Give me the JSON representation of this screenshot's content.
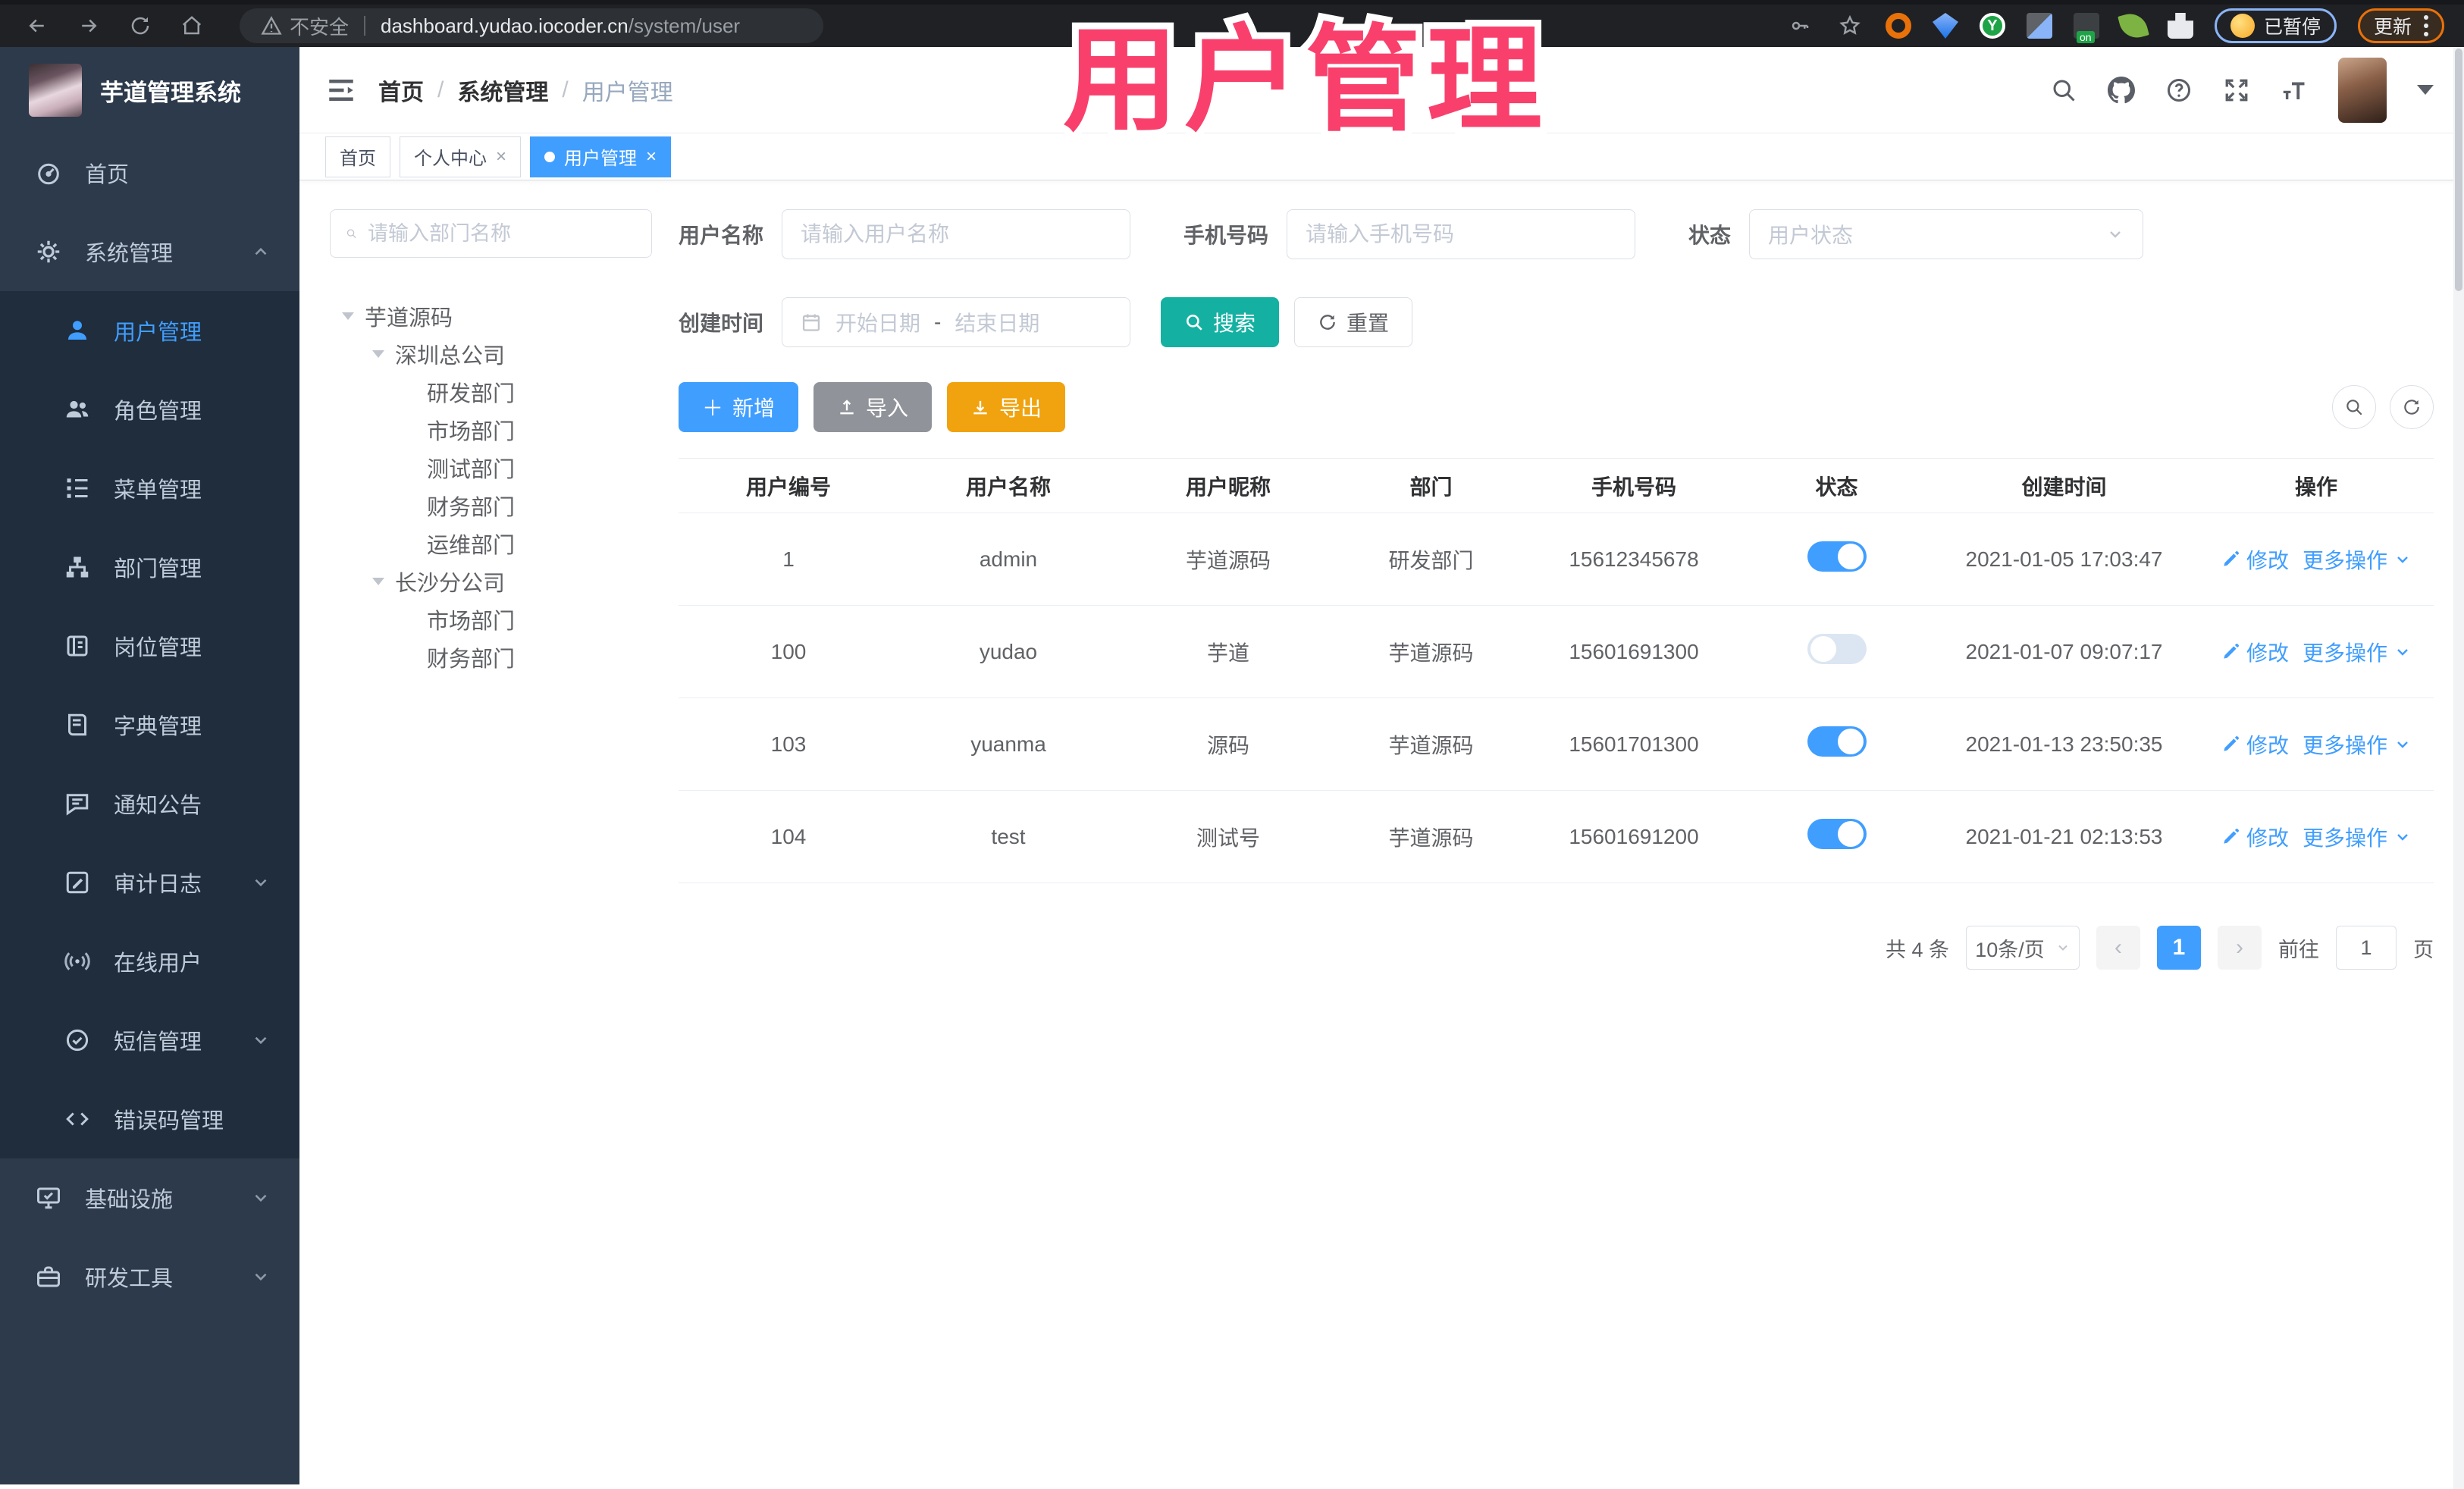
{
  "browser": {
    "security_label": "不安全",
    "url_domain": "dashboard.yudao.iocoder.cn",
    "url_path": "/system/user",
    "paused_label": "已暂停",
    "update_label": "更新"
  },
  "overlay_title": "用户管理",
  "sidebar": {
    "app_title": "芋道管理系统",
    "menu": {
      "home": "首页",
      "system": "系统管理"
    },
    "submenu": [
      {
        "label": "用户管理"
      },
      {
        "label": "角色管理"
      },
      {
        "label": "菜单管理"
      },
      {
        "label": "部门管理"
      },
      {
        "label": "岗位管理"
      },
      {
        "label": "字典管理"
      },
      {
        "label": "通知公告"
      },
      {
        "label": "审计日志"
      },
      {
        "label": "在线用户"
      },
      {
        "label": "短信管理"
      },
      {
        "label": "错误码管理"
      }
    ],
    "groups": [
      {
        "label": "基础设施"
      },
      {
        "label": "研发工具"
      }
    ]
  },
  "header": {
    "breadcrumb": [
      "首页",
      "系统管理",
      "用户管理"
    ]
  },
  "tabs": [
    {
      "label": "首页"
    },
    {
      "label": "个人中心"
    },
    {
      "label": "用户管理"
    }
  ],
  "dept": {
    "search_placeholder": "请输入部门名称",
    "tree": [
      {
        "label": "芋道源码"
      },
      {
        "label": "深圳总公司"
      },
      {
        "label": "研发部门"
      },
      {
        "label": "市场部门"
      },
      {
        "label": "测试部门"
      },
      {
        "label": "财务部门"
      },
      {
        "label": "运维部门"
      },
      {
        "label": "长沙分公司"
      },
      {
        "label": "市场部门"
      },
      {
        "label": "财务部门"
      }
    ]
  },
  "filters": {
    "name_label": "用户名称",
    "name_placeholder": "请输入用户名称",
    "phone_label": "手机号码",
    "phone_placeholder": "请输入手机号码",
    "status_label": "状态",
    "status_placeholder": "用户状态",
    "time_label": "创建时间",
    "date_start": "开始日期",
    "date_separator": "-",
    "date_end": "结束日期",
    "search_label": "搜索",
    "reset_label": "重置"
  },
  "toolbar": {
    "add_label": "新增",
    "import_label": "导入",
    "export_label": "导出"
  },
  "table": {
    "columns": [
      "用户编号",
      "用户名称",
      "用户昵称",
      "部门",
      "手机号码",
      "状态",
      "创建时间",
      "操作"
    ],
    "rows": [
      {
        "id": "1",
        "username": "admin",
        "nickname": "芋道源码",
        "dept": "研发部门",
        "phone": "15612345678",
        "status_on": true,
        "created": "2021-01-05 17:03:47"
      },
      {
        "id": "100",
        "username": "yudao",
        "nickname": "芋道",
        "dept": "芋道源码",
        "phone": "15601691300",
        "status_on": false,
        "created": "2021-01-07 09:07:17"
      },
      {
        "id": "103",
        "username": "yuanma",
        "nickname": "源码",
        "dept": "芋道源码",
        "phone": "15601701300",
        "status_on": true,
        "created": "2021-01-13 23:50:35"
      },
      {
        "id": "104",
        "username": "test",
        "nickname": "测试号",
        "dept": "芋道源码",
        "phone": "15601691200",
        "status_on": true,
        "created": "2021-01-21 02:13:53"
      }
    ],
    "actions": {
      "edit": "修改",
      "more": "更多操作"
    }
  },
  "pagination": {
    "total": "共 4 条",
    "page_size": "10条/页",
    "current_page": "1",
    "goto_label": "前往",
    "goto_value": "1",
    "page_unit": "页"
  }
}
